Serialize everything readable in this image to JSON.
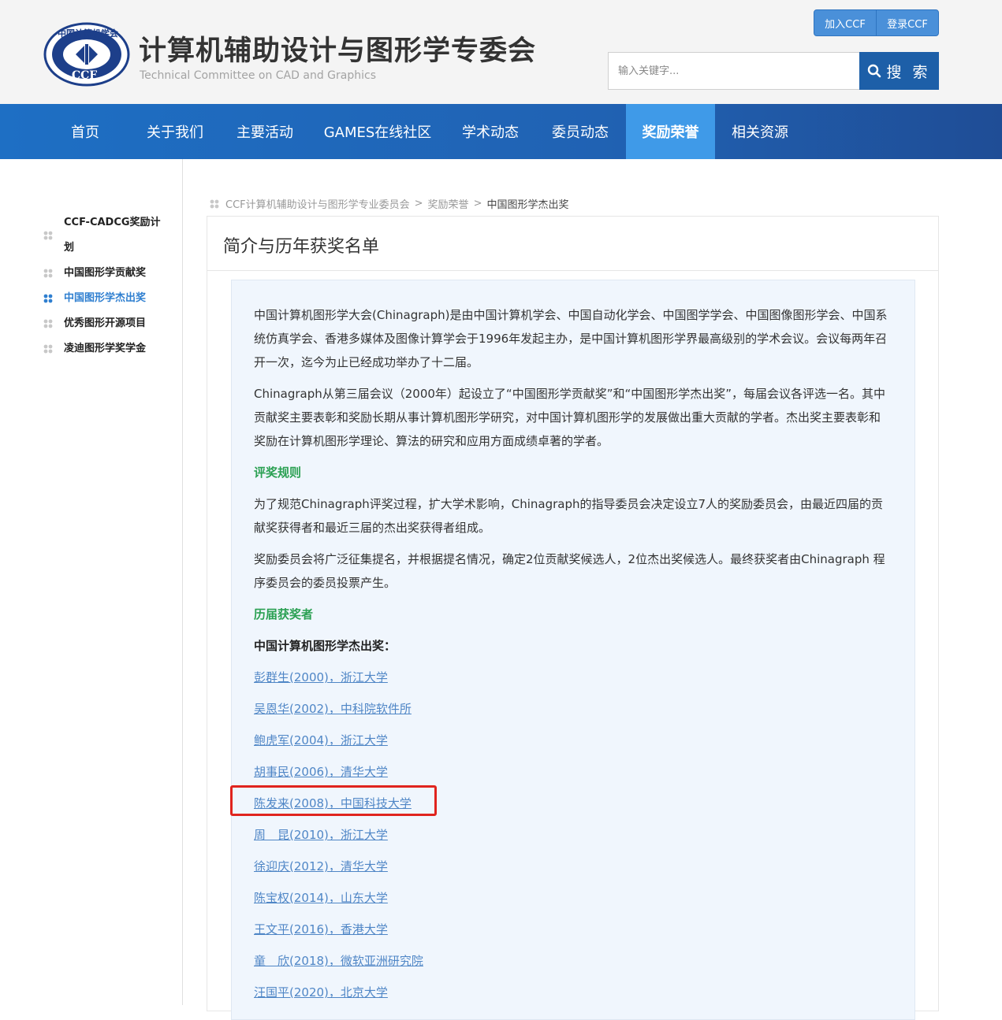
{
  "header": {
    "logo_text_top": "中国计算机学会",
    "logo_text_bottom": "CCF",
    "title": "计算机辅助设计与图形学专委会",
    "subtitle": "Technical Committee on CAD and Graphics",
    "join_label": "加入CCF",
    "login_label": "登录CCF",
    "search_placeholder": "输入关键字...",
    "search_label": "搜 索"
  },
  "nav": {
    "items": [
      {
        "label": "首页"
      },
      {
        "label": "关于我们"
      },
      {
        "label": "主要活动"
      },
      {
        "label": "GAMES在线社区"
      },
      {
        "label": "学术动态"
      },
      {
        "label": "委员动态"
      },
      {
        "label": "奖励荣誉",
        "active": true
      },
      {
        "label": "相关资源"
      }
    ]
  },
  "sidebar": {
    "items": [
      {
        "label_line1": "CCF-CADCG奖励计",
        "label_line2": "划"
      },
      {
        "label": "中国图形学贡献奖"
      },
      {
        "label": "中国图形学杰出奖",
        "active": true
      },
      {
        "label": "优秀图形开源项目"
      },
      {
        "label": "凌迪图形学奖学金"
      }
    ]
  },
  "breadcrumb": {
    "items": [
      "CCF计算机辅助设计与图形学专业委员会",
      "奖励荣誉",
      "中国图形学杰出奖"
    ],
    "separator": ">"
  },
  "main": {
    "title": "简介与历年获奖名单",
    "paragraphs": [
      "中国计算机图形学大会(Chinagraph)是由中国计算机学会、中国自动化学会、中国图学学会、中国图像图形学会、中国系统仿真学会、香港多媒体及图像计算学会于1996年发起主办，是中国计算机图形学界最高级别的学术会议。会议每两年召开一次，迄今为止已经成功举办了十二届。",
      "Chinagraph从第三届会议（2000年）起设立了“中国图形学贡献奖”和“中国图形学杰出奖”，每届会议各评选一名。其中贡献奖主要表彰和奖励长期从事计算机图形学研究，对中国计算机图形学的发展做出重大贡献的学者。杰出奖主要表彰和奖励在计算机图形学理论、算法的研究和应用方面成绩卓著的学者。"
    ],
    "rules_heading": "评奖规则",
    "rules_paragraphs": [
      "为了规范Chinagraph评奖过程，扩大学术影响，Chinagraph的指导委员会决定设立7人的奖励委员会，由最近四届的贡献奖获得者和最近三届的杰出奖获得者组成。",
      "奖励委员会将广泛征集提名，并根据提名情况，确定2位贡献奖候选人，2位杰出奖候选人。最终获奖者由Chinagraph 程序委员会的委员投票产生。"
    ],
    "winners_heading": "历届获奖者",
    "award_name": "中国计算机图形学杰出奖：",
    "winners": [
      "彭群生(2000)，浙江大学",
      "吴恩华(2002)，中科院软件所",
      "鲍虎军(2004)，浙江大学",
      "胡事民(2006)，清华大学",
      "陈发来(2008)，中国科技大学",
      "周　昆(2010)，浙江大学",
      "徐迎庆(2012)，清华大学",
      "陈宝权(2014)，山东大学",
      "王文平(2016)，香港大学",
      "童　欣(2018)，微软亚洲研究院",
      "汪国平(2020)，北京大学"
    ]
  },
  "colors": {
    "nav_bg": "#2062b3",
    "nav_active": "#3f9ae8",
    "search_button": "#1d5fa8",
    "heading_green": "#2aa052",
    "link_blue": "#4f86c6",
    "highlight_red": "#e0241e",
    "panel_bg": "#f0f6fd"
  }
}
